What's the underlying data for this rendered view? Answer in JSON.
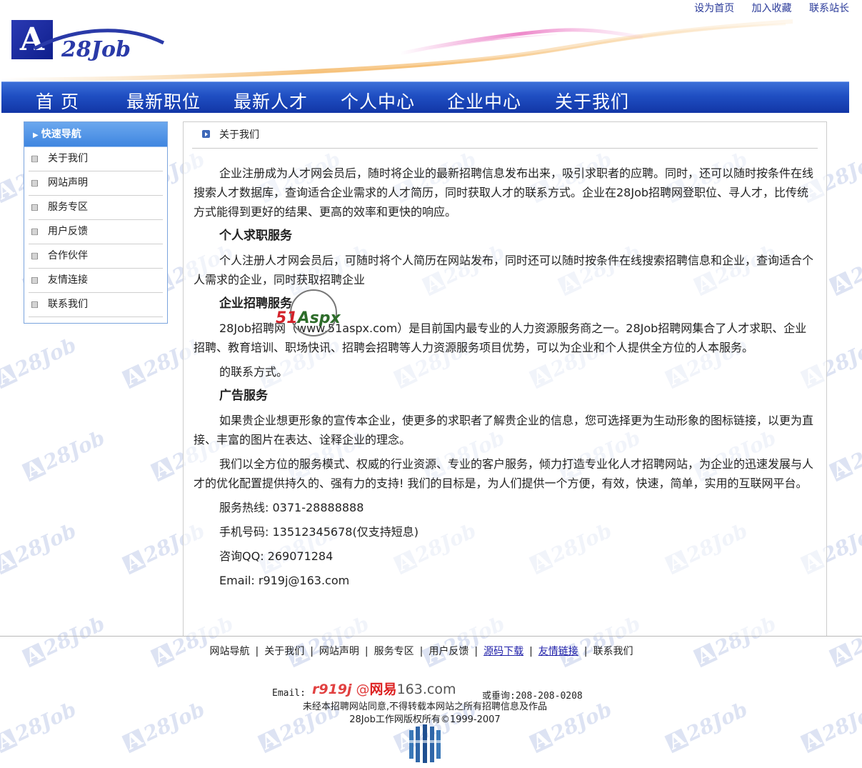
{
  "header": {
    "logo_text": "28Job",
    "logo_letter": "A",
    "links": [
      "设为首页",
      "加入收藏",
      "联系站长"
    ]
  },
  "nav": {
    "items": [
      "首 页",
      "最新职位",
      "最新人才",
      "个人中心",
      "企业中心",
      "关于我们"
    ]
  },
  "sidebar": {
    "title": "快速导航",
    "items": [
      "关于我们",
      "网站声明",
      "服务专区",
      "用户反馈",
      "合作伙伴",
      "友情连接",
      "联系我们"
    ]
  },
  "main": {
    "title": "关于我们",
    "p1": "企业注册成为人才网会员后，随时将企业的最新招聘信息发布出来，吸引求职者的应聘。同时，还可以随时按条件在线搜索人才数据库，查询适合企业需求的人才简历，同时获取人才的联系方式。企业在28Job招聘网登职位、寻人才，比传统方式能得到更好的结果、更高的效率和更快的响应。",
    "h1": "个人求职服务",
    "p2": "个人注册人才网会员后，可随时将个人简历在网站发布，同时还可以随时按条件在线搜索招聘信息和企业，查询适合个人需求的企业，同时获取招聘企业",
    "h2": "企业招聘服务",
    "p3": "28Job招聘网（www.51aspx.com）是目前国内最专业的人力资源服务商之一。28Job招聘网集合了人才求职、企业招聘、教育培训、职场快讯、招聘会招聘等人力资源服务项目优势，可以为企业和个人提供全方位的人本服务。",
    "p4": "的联系方式。",
    "h3": "广告服务",
    "p5": "如果贵企业想更形象的宣传本企业，使更多的求职者了解贵企业的信息，您可选择更为生动形象的图标链接，以更为直接、丰富的图片在表达、诠释企业的理念。",
    "p6": "我们以全方位的服务模式、权威的行业资源、专业的客户服务，倾力打造专业化人才招聘网站，为企业的迅速发展与人才的优化配置提供持久的、强有力的支持!  我们的目标是，为人们提供一个方便，有效，快速，简单，实用的互联网平台。",
    "hotline": "服务热线: 0371-28888888",
    "mobile": "手机号码: 13512345678(仅支持短息)",
    "qq": "咨询QQ: 269071284",
    "email": "Email: r919j@163.com"
  },
  "overlay": {
    "text_red": "51",
    "text_green": "Aspx"
  },
  "footer": {
    "links": [
      {
        "label": "网站导航",
        "underline": false
      },
      {
        "label": "关于我们",
        "underline": false
      },
      {
        "label": "网站声明",
        "underline": false
      },
      {
        "label": "服务专区",
        "underline": false
      },
      {
        "label": "用户反馈",
        "underline": false
      },
      {
        "label": "源码下载",
        "underline": true
      },
      {
        "label": "友情链接",
        "underline": true
      },
      {
        "label": "联系我们",
        "underline": false
      }
    ],
    "email_label": "Email:",
    "email_image_user": "r919j",
    "email_image_at": "@",
    "email_image_brand": "网易",
    "email_image_domain": "163.com",
    "phone": "或垂询:208-208-0208",
    "notice": "未经本招聘网站同意,不得转载本网站之所有招聘信息及作品",
    "copyright": "28Job工作网版权所有©1999-2007"
  }
}
